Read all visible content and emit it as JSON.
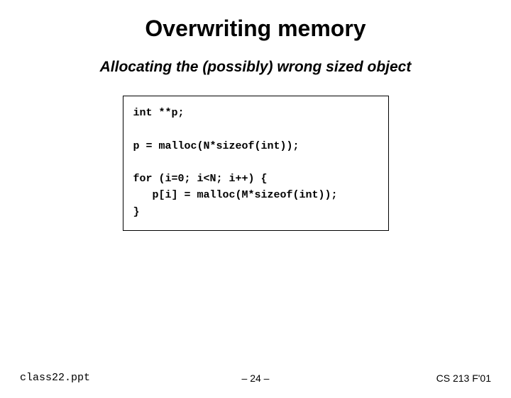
{
  "title": "Overwriting memory",
  "subtitle": "Allocating the (possibly) wrong\nsized object",
  "code": "int **p;\n\np = malloc(N*sizeof(int));\n\nfor (i=0; i<N; i++) {\n   p[i] = malloc(M*sizeof(int));\n}",
  "footer": {
    "left": "class22.ppt",
    "center": "– 24 –",
    "right": "CS 213 F'01"
  }
}
